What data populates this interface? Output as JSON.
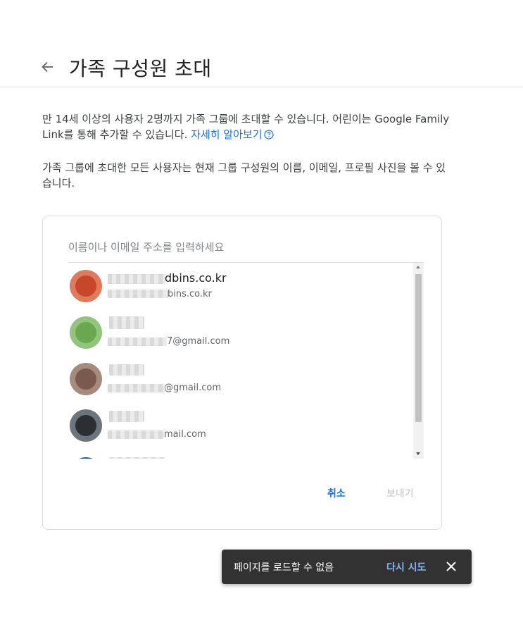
{
  "header": {
    "title": "가족 구성원 초대"
  },
  "description": {
    "p1_text": "만 14세 이상의 사용자 2명까지 가족 그룹에 초대할 수 있습니다. 어린이는 Google Family Link를 통해 추가할 수 있습니다. ",
    "p1_link": "자세히 알아보기",
    "p2_text": "가족 그룹에 초대한 모든 사용자는 현재 그룹 구성원의 이름, 이메일, 프로필 사진을 볼 수 있습니다."
  },
  "search": {
    "placeholder": "이름이나 이메일 주소를 입력하세요",
    "value": ""
  },
  "contacts": [
    {
      "name": "dbins.co.kr",
      "email": "bins.co.kr",
      "avatar_color": "#c8472a"
    },
    {
      "name": "",
      "email": "7@gmail.com",
      "avatar_color": "#6aa84f"
    },
    {
      "name": "",
      "email": "@gmail.com",
      "avatar_color": "#7a5a4e"
    },
    {
      "name": "",
      "email": "mail.com",
      "avatar_color": "#3a3f44"
    }
  ],
  "actions": {
    "cancel_label": "취소",
    "send_label": "보내기"
  },
  "snackbar": {
    "message": "페이지를 로드할 수 없음",
    "action_label": "다시 시도"
  },
  "colors": {
    "accent": "#1a73e8",
    "snackbar_bg": "#323232",
    "snackbar_action": "#8ab4f8",
    "disabled": "#bdc1c6"
  }
}
